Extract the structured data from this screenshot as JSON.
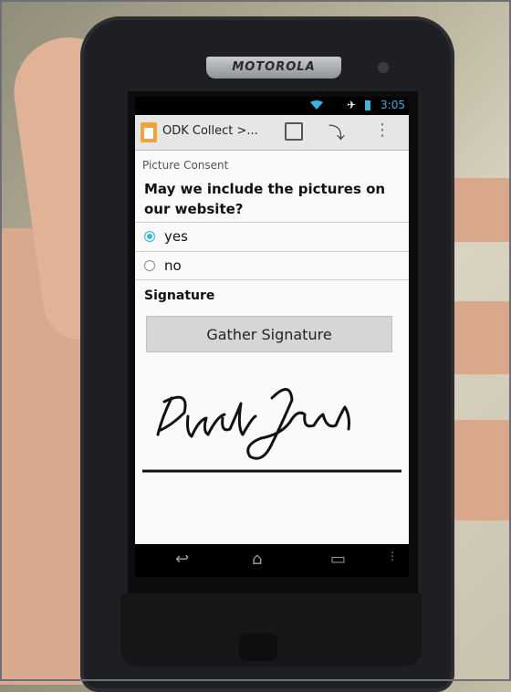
{
  "device": {
    "brand": "MOTOROLA",
    "time": "3:05"
  },
  "app": {
    "title": "ODK Collect >..."
  },
  "form": {
    "group_label": "Picture Consent",
    "question": "May we include the pictures on our website?",
    "options": [
      {
        "label": "yes",
        "selected": true
      },
      {
        "label": "no",
        "selected": false
      }
    ],
    "signature_label": "Signature",
    "gather_button": "Gather Signature"
  },
  "colors": {
    "accent": "#33b5e5",
    "actionbar": "#e6e6e6",
    "button": "#d6d6d6"
  }
}
